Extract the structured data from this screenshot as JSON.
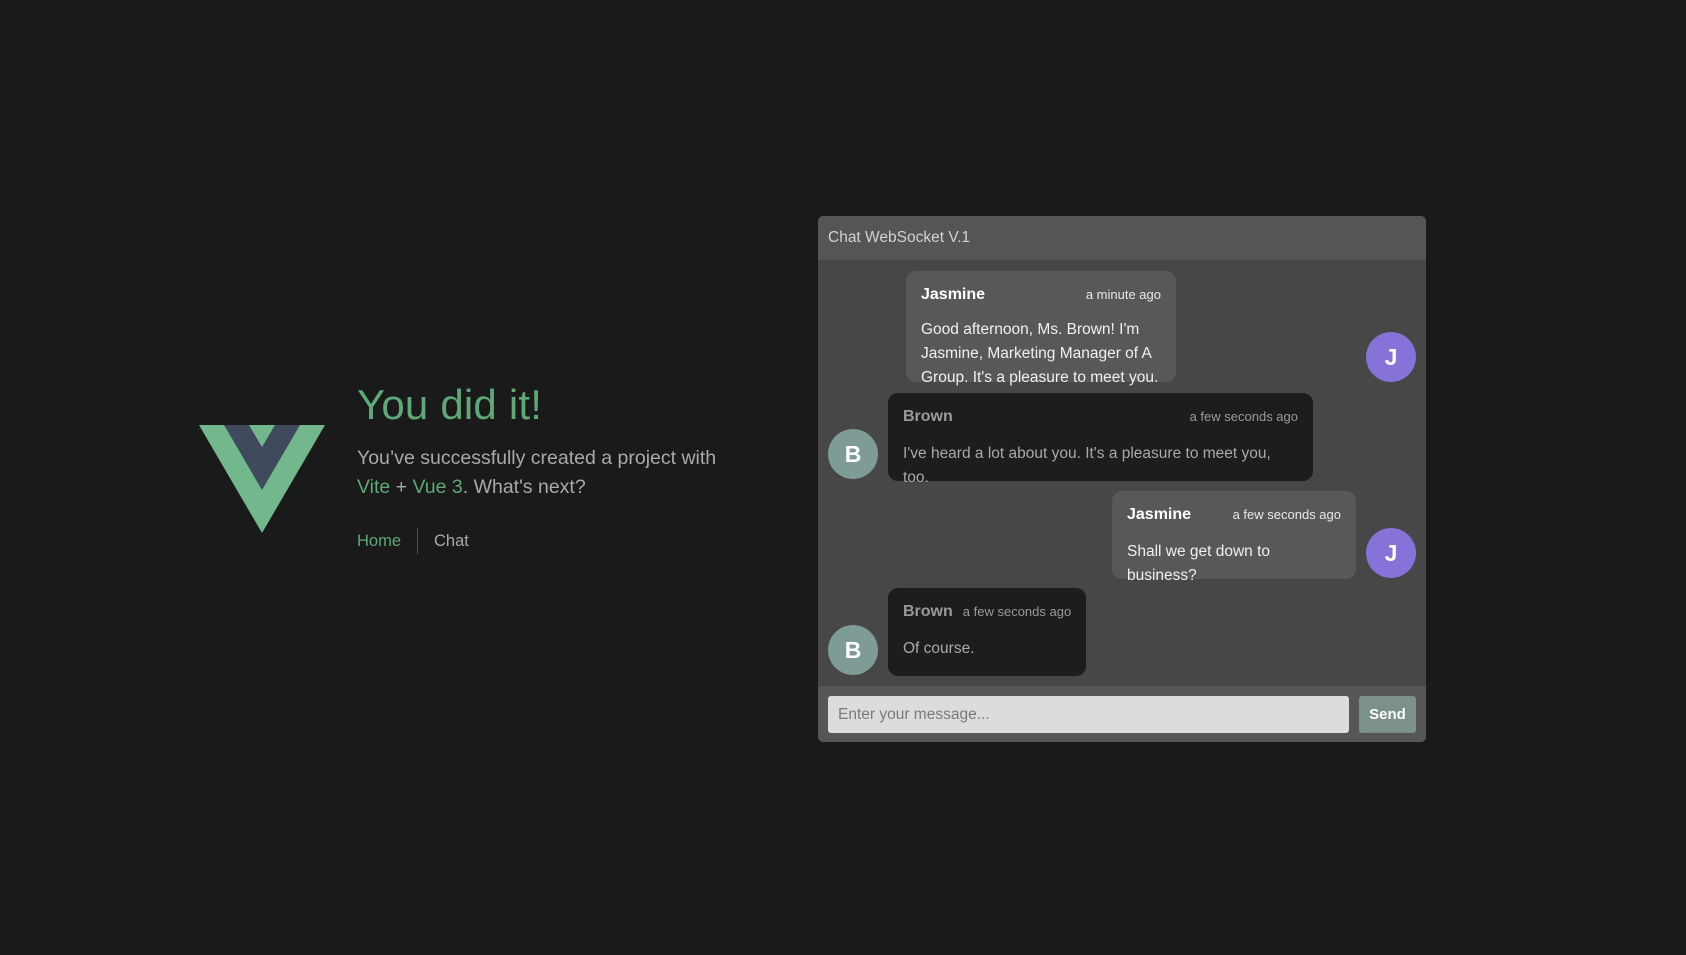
{
  "hero": {
    "title": "You did it!",
    "subtitle_prefix": "You’ve successfully created a project with",
    "link_vite": "Vite",
    "plus": " + ",
    "link_vue": "Vue 3",
    "subtitle_suffix": ". What's next?"
  },
  "nav": {
    "home": "Home",
    "chat": "Chat"
  },
  "chat": {
    "title": "Chat WebSocket V.1",
    "messages": [
      {
        "sender": "Jasmine",
        "initial": "J",
        "time": "a minute ago",
        "text": "Good afternoon, Ms. Brown! I'm Jasmine, Marketing Manager of A Group. It's a pleasure to meet you.",
        "side": "right"
      },
      {
        "sender": "Brown",
        "initial": "B",
        "time": "a few seconds ago",
        "text": "I've heard a lot about you. It's a pleasure to meet you, too.",
        "side": "left"
      },
      {
        "sender": "Jasmine",
        "initial": "J",
        "time": "a few seconds ago",
        "text": "Shall we get down to business?",
        "side": "right"
      },
      {
        "sender": "Brown",
        "initial": "B",
        "time": "a few seconds ago",
        "text": "Of course.",
        "side": "left"
      }
    ],
    "input_placeholder": "Enter your message...",
    "input_value": "",
    "send_label": "Send"
  },
  "colors": {
    "background": "#1a1a1a",
    "vue_green": "#5fa877",
    "vue_dark": "#35495e",
    "jasmine_avatar": "#8672d8",
    "brown_avatar": "#7f9b98",
    "send_button": "#7c918a"
  }
}
